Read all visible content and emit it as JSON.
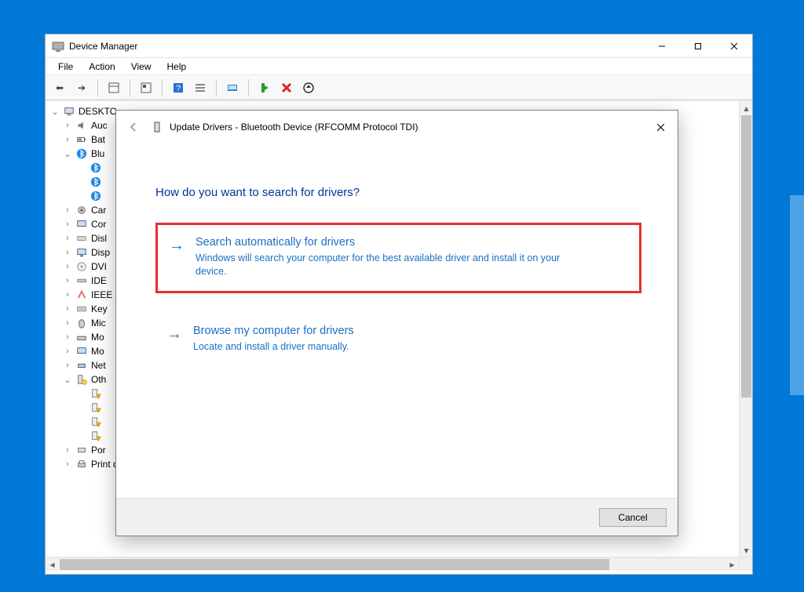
{
  "device_manager": {
    "title": "Device Manager",
    "menu": {
      "file": "File",
      "action": "Action",
      "view": "View",
      "help": "Help"
    },
    "root": "DESKTO",
    "nodes": [
      {
        "label": "Auc"
      },
      {
        "label": "Bat"
      },
      {
        "label": "Blu",
        "children": 3
      },
      {
        "label": "Car"
      },
      {
        "label": "Cor"
      },
      {
        "label": "Disl"
      },
      {
        "label": "Disp"
      },
      {
        "label": "DVI"
      },
      {
        "label": "IDE"
      },
      {
        "label": "IEEE"
      },
      {
        "label": "Key"
      },
      {
        "label": "Mic"
      },
      {
        "label": "Mo"
      },
      {
        "label": "Mo"
      },
      {
        "label": "Net"
      },
      {
        "label": "Oth",
        "children": 4,
        "warn": true
      },
      {
        "label": "Por"
      },
      {
        "label": "Print queues"
      }
    ]
  },
  "dialog": {
    "title": "Update Drivers - Bluetooth Device (RFCOMM Protocol TDI)",
    "heading": "How do you want to search for drivers?",
    "option1": {
      "title": "Search automatically for drivers",
      "desc": "Windows will search your computer for the best available driver and install it on your device."
    },
    "option2": {
      "title": "Browse my computer for drivers",
      "desc": "Locate and install a driver manually."
    },
    "cancel": "Cancel"
  },
  "colors": {
    "accent": "#0078d7",
    "link": "#1b6fc2",
    "highlight": "#e63030"
  }
}
